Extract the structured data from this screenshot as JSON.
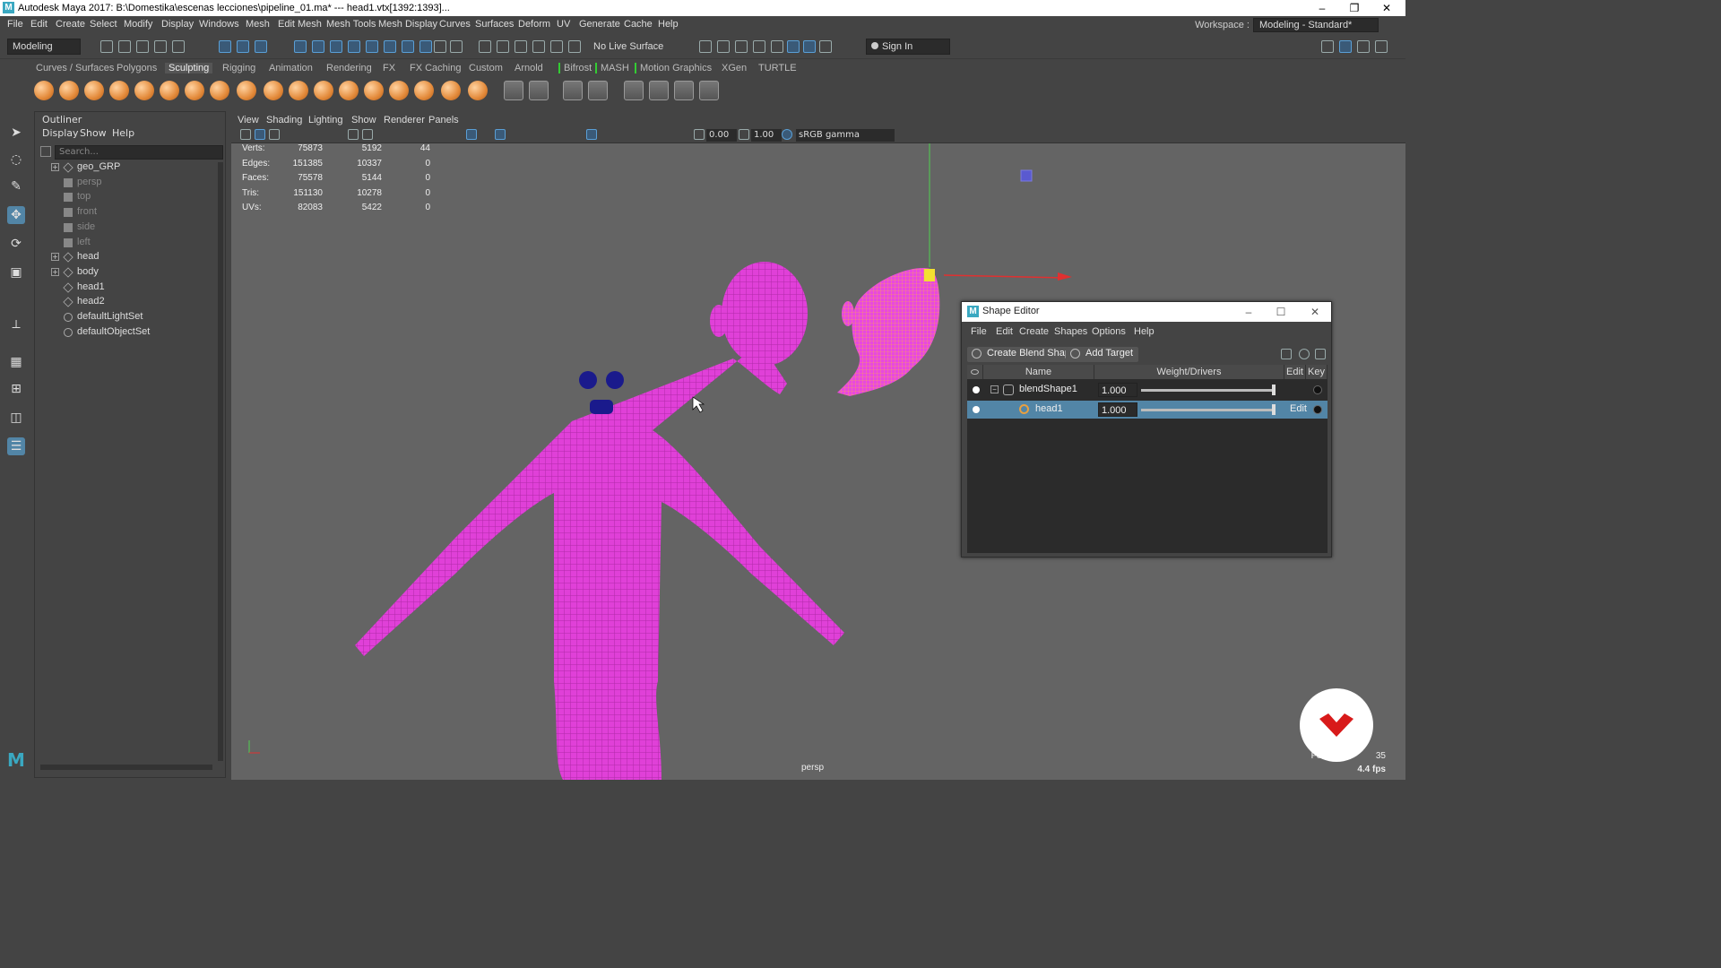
{
  "titlebar": {
    "title": "Autodesk Maya 2017: B:\\Domestika\\escenas lecciones\\pipeline_01.ma*   ---   head1.vtx[1392:1393]..."
  },
  "menubar": {
    "items": [
      "File",
      "Edit",
      "Create",
      "Select",
      "Modify",
      "Display",
      "Windows",
      "Mesh",
      "Edit Mesh",
      "Mesh Tools",
      "Mesh Display",
      "Curves",
      "Surfaces",
      "Deform",
      "UV",
      "Generate",
      "Cache",
      "Help"
    ],
    "workspace_label": "Workspace :",
    "workspace_value": "Modeling - Standard*"
  },
  "statusline": {
    "menuset": "Modeling",
    "live_surface": "No Live Surface",
    "sign_in": "Sign In"
  },
  "shelf": {
    "tabs": [
      "Curves / Surfaces",
      "Polygons",
      "Sculpting",
      "Rigging",
      "Animation",
      "Rendering",
      "FX",
      "FX Caching",
      "Custom",
      "Arnold",
      "Bifrost",
      "MASH",
      "Motion Graphics",
      "XGen",
      "TURTLE"
    ],
    "active_tab": "Sculpting"
  },
  "outliner": {
    "title": "Outliner",
    "menu": [
      "Display",
      "Show",
      "Help"
    ],
    "search_placeholder": "Search...",
    "items": [
      {
        "label": "geo_GRP",
        "dim": false,
        "expandable": true
      },
      {
        "label": "persp",
        "dim": true,
        "expandable": false
      },
      {
        "label": "top",
        "dim": true,
        "expandable": false
      },
      {
        "label": "front",
        "dim": true,
        "expandable": false
      },
      {
        "label": "side",
        "dim": true,
        "expandable": false
      },
      {
        "label": "left",
        "dim": true,
        "expandable": false
      },
      {
        "label": "head",
        "dim": false,
        "expandable": true
      },
      {
        "label": "body",
        "dim": false,
        "expandable": true
      },
      {
        "label": "head1",
        "dim": false,
        "expandable": false
      },
      {
        "label": "head2",
        "dim": false,
        "expandable": false
      },
      {
        "label": "defaultLightSet",
        "dim": false,
        "expandable": false
      },
      {
        "label": "defaultObjectSet",
        "dim": false,
        "expandable": false
      }
    ]
  },
  "viewport": {
    "menu": [
      "View",
      "Shading",
      "Lighting",
      "Show",
      "Renderer",
      "Panels"
    ],
    "exposure": "0.00",
    "gamma": "1.00",
    "color_space": "sRGB gamma",
    "camera": "persp",
    "focal_label": "Foca",
    "focal_value": "35",
    "fps": "4.4 fps",
    "hud": [
      {
        "label": "Verts:",
        "a": "75873",
        "b": "5192",
        "c": "44"
      },
      {
        "label": "Edges:",
        "a": "151385",
        "b": "10337",
        "c": "0"
      },
      {
        "label": "Faces:",
        "a": "75578",
        "b": "5144",
        "c": "0"
      },
      {
        "label": "Tris:",
        "a": "151130",
        "b": "10278",
        "c": "0"
      },
      {
        "label": "UVs:",
        "a": "82083",
        "b": "5422",
        "c": "0"
      }
    ],
    "mesh_color": "#e040d8"
  },
  "shape_editor": {
    "title": "Shape Editor",
    "menu": [
      "File",
      "Edit",
      "Create",
      "Shapes",
      "Options",
      "Help"
    ],
    "create_blend_shape": "Create Blend Shape",
    "add_target": "Add Target",
    "columns": {
      "name": "Name",
      "weight": "Weight/Drivers",
      "edit": "Edit",
      "key": "Key"
    },
    "rows": [
      {
        "name": "blendShape1",
        "weight": "1.000",
        "edit": "",
        "selected": false,
        "slider_level": 1.0
      },
      {
        "name": "head1",
        "weight": "1.000",
        "edit": "Edit",
        "selected": true,
        "slider_level": 1.0
      }
    ]
  }
}
